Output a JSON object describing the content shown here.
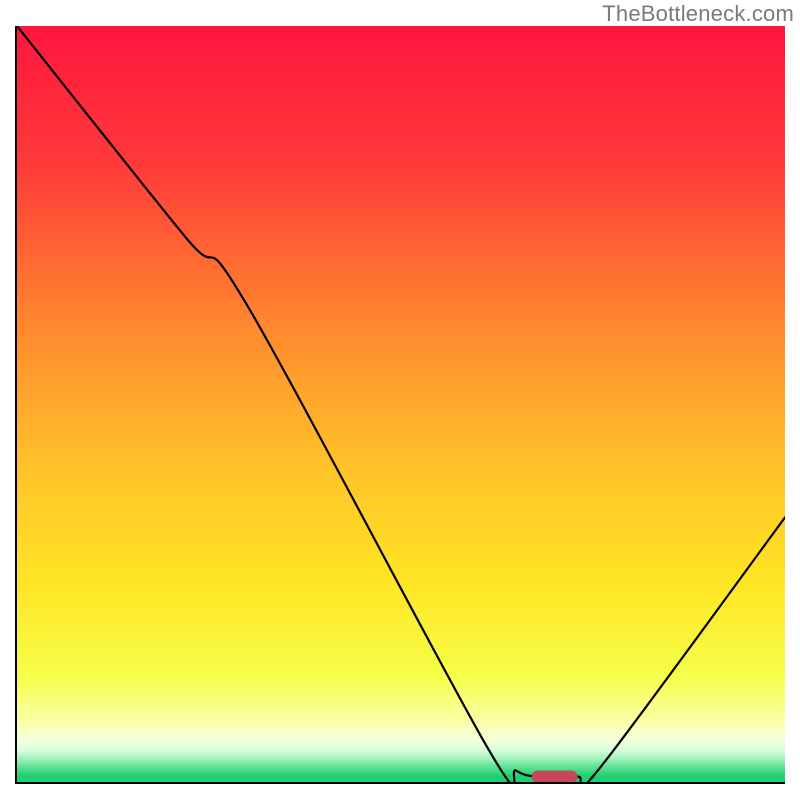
{
  "watermark": "TheBottleneck.com",
  "chart_data": {
    "type": "line",
    "title": "",
    "xlabel": "",
    "ylabel": "",
    "xlim": [
      0,
      100
    ],
    "ylim": [
      0,
      100
    ],
    "curve": [
      {
        "x": 0,
        "y": 100
      },
      {
        "x": 22,
        "y": 72
      },
      {
        "x": 30,
        "y": 63
      },
      {
        "x": 61,
        "y": 5
      },
      {
        "x": 65,
        "y": 1.5
      },
      {
        "x": 68,
        "y": 0.7
      },
      {
        "x": 73,
        "y": 0.7
      },
      {
        "x": 76,
        "y": 2
      },
      {
        "x": 100,
        "y": 35
      }
    ],
    "optimal_marker": {
      "x": 70,
      "y": 0.7,
      "width": 6,
      "height": 1.6
    },
    "gradient_stops": [
      {
        "t": 0.0,
        "color": "#ff163e"
      },
      {
        "t": 0.18,
        "color": "#ff3a3a"
      },
      {
        "t": 0.4,
        "color": "#ff8a2e"
      },
      {
        "t": 0.58,
        "color": "#ffc229"
      },
      {
        "t": 0.74,
        "color": "#ffe625"
      },
      {
        "t": 0.86,
        "color": "#f6ff4a"
      },
      {
        "t": 0.92,
        "color": "#fbffa7"
      },
      {
        "t": 0.945,
        "color": "#f4ffde"
      },
      {
        "t": 0.958,
        "color": "#d6ffdb"
      },
      {
        "t": 0.97,
        "color": "#9cf2b9"
      },
      {
        "t": 0.982,
        "color": "#53e08f"
      },
      {
        "t": 0.992,
        "color": "#20cf71"
      },
      {
        "t": 1.0,
        "color": "#20cf71"
      }
    ]
  }
}
